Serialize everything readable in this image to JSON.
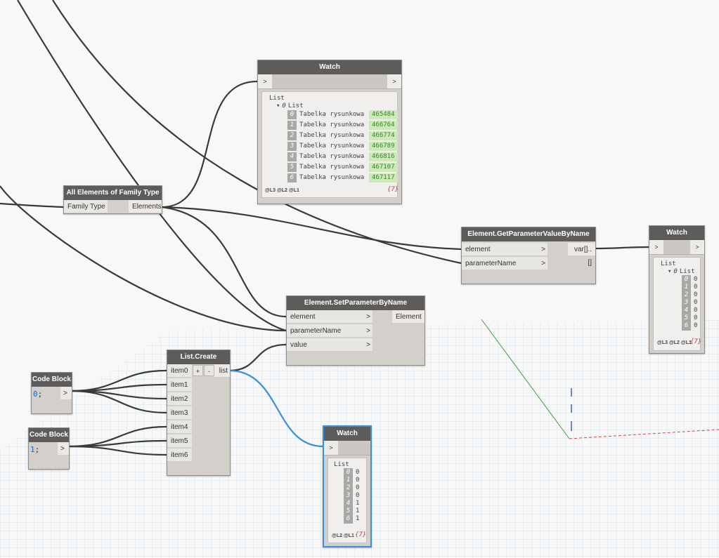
{
  "colors": {
    "wire": "#3a3a3a",
    "wire_selected": "#3b8ede",
    "node_header": "#5e5c5a",
    "node_body": "#d3d0cb",
    "value_green": "#cfe8b8"
  },
  "icons": {
    "port_arrow": "chevron-right-icon",
    "collapse": "triangle-down-icon"
  },
  "watch_top": {
    "title": "Watch",
    "port_in": ">",
    "port_out": ">",
    "root_label": "List",
    "sub_index": "0",
    "sub_label": "List",
    "items": [
      {
        "index": "0",
        "label": "Tabelka rysunkowa",
        "value": "465484"
      },
      {
        "index": "1",
        "label": "Tabelka rysunkowa",
        "value": "466764"
      },
      {
        "index": "2",
        "label": "Tabelka rysunkowa",
        "value": "466774"
      },
      {
        "index": "3",
        "label": "Tabelka rysunkowa",
        "value": "466789"
      },
      {
        "index": "4",
        "label": "Tabelka rysunkowa",
        "value": "466816"
      },
      {
        "index": "5",
        "label": "Tabelka rysunkowa",
        "value": "467107"
      },
      {
        "index": "6",
        "label": "Tabelka rysunkowa",
        "value": "467117"
      }
    ],
    "levels": "@L3 @L2 @L1",
    "count": "{7}"
  },
  "all_elements": {
    "title": "All Elements of Family Type",
    "input": "Family Type",
    "output": "Elements"
  },
  "get_param": {
    "title": "Element.GetParameterValueByName",
    "in1": "element",
    "in2": "parameterName",
    "out": "var[]..[]",
    "chev": ">"
  },
  "watch_right": {
    "title": "Watch",
    "port_in": ">",
    "port_out": ">",
    "root_label": "List",
    "sub_index": "0",
    "sub_label": "List",
    "items": [
      {
        "index": "0",
        "value": "0"
      },
      {
        "index": "1",
        "value": "0"
      },
      {
        "index": "2",
        "value": "0"
      },
      {
        "index": "3",
        "value": "0"
      },
      {
        "index": "4",
        "value": "0"
      },
      {
        "index": "5",
        "value": "0"
      },
      {
        "index": "6",
        "value": "0"
      }
    ],
    "levels": "@L3 @L2 @L1",
    "count": "{7}"
  },
  "set_param": {
    "title": "Element.SetParameterByName",
    "in1": "element",
    "in2": "parameterName",
    "in3": "value",
    "out": "Element",
    "chev": ">"
  },
  "list_create": {
    "title": "List.Create",
    "items": [
      "item0",
      "item1",
      "item2",
      "item3",
      "item4",
      "item5",
      "item6"
    ],
    "plus": "+",
    "minus": "-",
    "out": "list"
  },
  "code_block_1": {
    "title": "Code Block",
    "num": "0",
    "semi": ";",
    "out": ">"
  },
  "code_block_2": {
    "title": "Code Block",
    "num": "1",
    "semi": ";",
    "out": ">"
  },
  "watch_bottom": {
    "title": "Watch",
    "port_in": ">",
    "root_label": "List",
    "items": [
      {
        "index": "0",
        "value": "0"
      },
      {
        "index": "1",
        "value": "0"
      },
      {
        "index": "2",
        "value": "0"
      },
      {
        "index": "3",
        "value": "0"
      },
      {
        "index": "4",
        "value": "1"
      },
      {
        "index": "5",
        "value": "1"
      },
      {
        "index": "6",
        "value": "1"
      }
    ],
    "levels": "@L2 @L1",
    "count": "{7}"
  }
}
